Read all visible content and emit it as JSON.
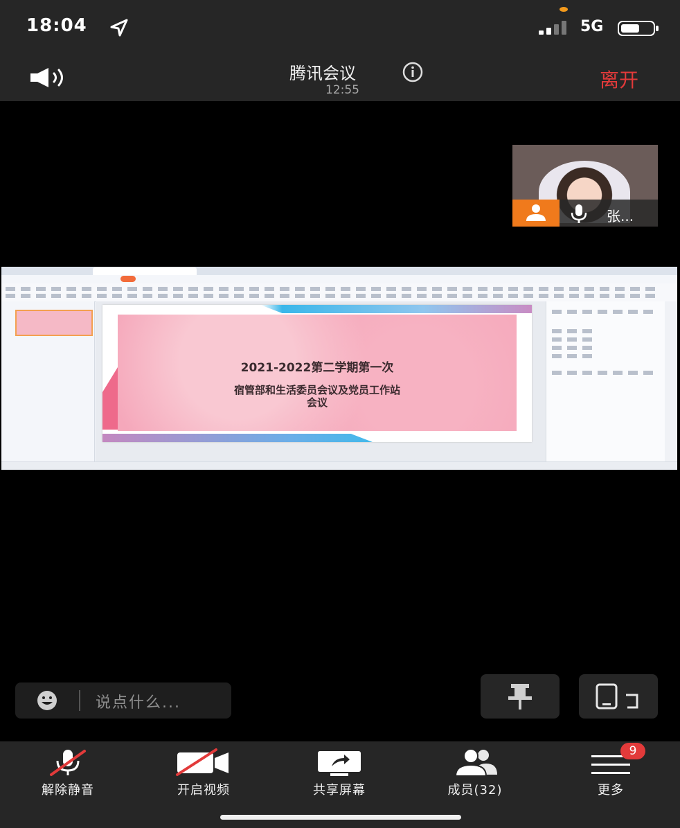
{
  "status_bar": {
    "time": "18:04",
    "network": "5G",
    "icons": [
      "location-arrow-icon",
      "signal-icon",
      "battery-icon"
    ]
  },
  "header": {
    "title": "腾讯会议",
    "duration": "12:55",
    "leave_label": "离开",
    "leave_color": "#e23a3a",
    "icons": [
      "speaker-icon",
      "info-icon"
    ]
  },
  "participant": {
    "name": "张...",
    "badge_color": "#f07a1c",
    "icons": [
      "host-person-icon",
      "microphone-icon"
    ]
  },
  "shared_screen": {
    "slide": {
      "title": "2021-2022第二学期第一次",
      "subtitle_line1": "宿管部和生活委员会议及党员工作站",
      "subtitle_line2": "会议"
    }
  },
  "chat": {
    "placeholder": "说点什么...",
    "icons": [
      "emoji-icon"
    ]
  },
  "floating_buttons": {
    "icons": [
      "pin-icon",
      "rotate-screen-icon"
    ]
  },
  "toolbar": {
    "items": [
      {
        "label": "解除静音",
        "icon": "microphone-muted-icon"
      },
      {
        "label": "开启视频",
        "icon": "video-off-icon"
      },
      {
        "label": "共享屏幕",
        "icon": "share-screen-icon"
      },
      {
        "label": "成员(32)",
        "icon": "members-icon"
      },
      {
        "label": "更多",
        "icon": "menu-icon"
      }
    ],
    "more_badge": "9",
    "badge_color": "#e23a3a"
  }
}
